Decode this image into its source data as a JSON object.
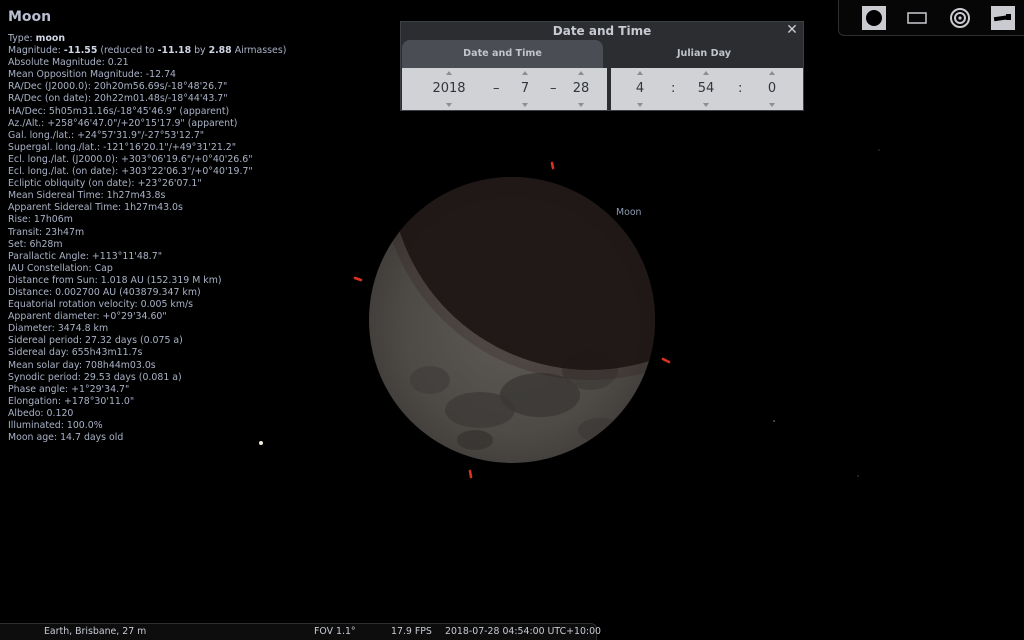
{
  "object": {
    "name": "Moon",
    "type_label": "Type: ",
    "type_value": "moon",
    "magnitude_prefix": "Magnitude: ",
    "magnitude_value": "-11.55",
    "magnitude_mid": " (reduced to ",
    "magnitude_reduced": "-11.18",
    "magnitude_by": " by ",
    "airmasses": "2.88",
    "airmasses_suffix": " Airmasses)",
    "lines": [
      "Absolute Magnitude: 0.21",
      "Mean Opposition Magnitude: -12.74",
      "RA/Dec (J2000.0): 20h20m56.69s/-18°48'26.7\"",
      "RA/Dec (on date): 20h22m01.48s/-18°44'43.7\"",
      "HA/Dec: 5h05m31.16s/-18°45'46.9\" (apparent)",
      "Az./Alt.: +258°46'47.0\"/+20°15'17.9\" (apparent)",
      "Gal. long./lat.: +24°57'31.9\"/-27°53'12.7\"",
      "Supergal. long./lat.: -121°16'20.1\"/+49°31'21.2\"",
      "Ecl. long./lat. (J2000.0): +303°06'19.6\"/+0°40'26.6\"",
      "Ecl. long./lat. (on date): +303°22'06.3\"/+0°40'19.7\"",
      "Ecliptic obliquity (on date): +23°26'07.1\"",
      "Mean Sidereal Time: 1h27m43.8s",
      "Apparent Sidereal Time: 1h27m43.0s",
      "Rise: 17h06m",
      "Transit: 23h47m",
      "Set: 6h28m",
      "Parallactic Angle: +113°11'48.7\"",
      "IAU Constellation: Cap",
      "Distance from Sun: 1.018 AU (152.319 M km)",
      "Distance: 0.002700 AU (403879.347 km)",
      "Equatorial rotation velocity: 0.005 km/s",
      "Apparent diameter: +0°29'34.60\"",
      "Diameter: 3474.8 km",
      "Sidereal period: 27.32 days (0.075 a)",
      "Sidereal day: 655h43m11.7s",
      "Mean solar day: 708h44m03.0s",
      "Synodic period: 29.53 days (0.081 a)",
      "Phase angle: +1°29'34.7\"",
      "Elongation: +178°30'11.0\"",
      "Albedo: 0.120",
      "Illuminated: 100.0%",
      "Moon age: 14.7 days old"
    ]
  },
  "sky_label": "Moon",
  "dialog": {
    "title": "Date and Time",
    "close_icon": "close-icon",
    "tabs": [
      "Date and Time",
      "Julian Day"
    ],
    "year": "2018",
    "month": "7",
    "day": "28",
    "hour": "4",
    "minute": "54",
    "second": "0",
    "date_sep": "–",
    "time_sep": ":"
  },
  "toolbar": {
    "icons": [
      "planet-icon",
      "rectangle-icon",
      "target-icon",
      "telescope-icon"
    ]
  },
  "status": {
    "location": "Earth, Brisbane, 27 m",
    "fov": "FOV 1.1°",
    "fps": "17.9 FPS",
    "datetime": "2018-07-28 04:54:00 UTC+10:00"
  },
  "colors": {
    "background": "#000000",
    "marker_red": "#d8321e",
    "dialog_bg": "#2b2d31",
    "fields_bg": "#d0d2d6"
  }
}
